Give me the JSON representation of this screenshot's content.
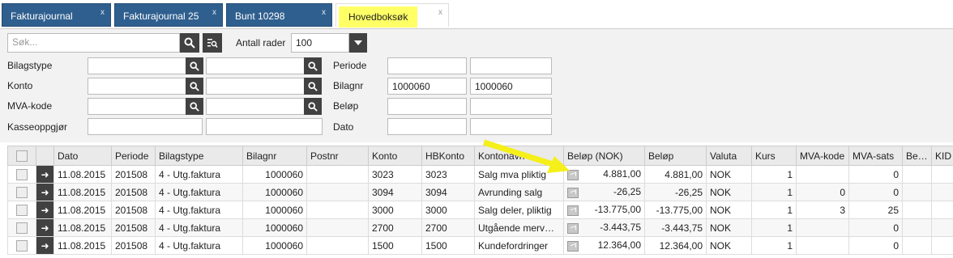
{
  "tabs": [
    {
      "label": "Fakturajournal",
      "close": "x"
    },
    {
      "label": "Fakturajournal 25",
      "close": "x"
    },
    {
      "label": "Bunt 10298",
      "close": "x"
    },
    {
      "label": "Hovedboksøk",
      "close": "x"
    }
  ],
  "search": {
    "placeholder": "Søk...",
    "rows_label": "Antall rader",
    "rows_value": "100"
  },
  "filters": {
    "bilagstype_label": "Bilagstype",
    "konto_label": "Konto",
    "mva_label": "MVA-kode",
    "kasse_label": "Kasseoppgjør",
    "periode_label": "Periode",
    "bilagnr_label": "Bilagnr",
    "belop_label": "Beløp",
    "dato_label": "Dato",
    "bilagnr_from": "1000060",
    "bilagnr_to": "1000060"
  },
  "grid": {
    "columns": [
      "Dato",
      "Periode",
      "Bilagstype",
      "Bilagnr",
      "Postnr",
      "Konto",
      "HBKonto",
      "Kontonavn",
      "Beløp (NOK)",
      "Beløp",
      "Valuta",
      "Kurs",
      "MVA-kode",
      "MVA-sats",
      "Be…",
      "KID"
    ],
    "rows": [
      {
        "dato": "11.08.2015",
        "periode": "201508",
        "bilagstype": "4 - Utg.faktura",
        "bilagnr": "1000060",
        "postnr": "",
        "konto": "3023",
        "hbkonto": "3023",
        "kontonavn": "Salg mva pliktig",
        "belop_nok": "4.881,00",
        "belop": "4.881,00",
        "valuta": "NOK",
        "kurs": "1",
        "mvakode": "",
        "mvasats": "0"
      },
      {
        "dato": "11.08.2015",
        "periode": "201508",
        "bilagstype": "4 - Utg.faktura",
        "bilagnr": "1000060",
        "postnr": "",
        "konto": "3094",
        "hbkonto": "3094",
        "kontonavn": "Avrunding salg",
        "belop_nok": "-26,25",
        "belop": "-26,25",
        "valuta": "NOK",
        "kurs": "1",
        "mvakode": "0",
        "mvasats": "0"
      },
      {
        "dato": "11.08.2015",
        "periode": "201508",
        "bilagstype": "4 - Utg.faktura",
        "bilagnr": "1000060",
        "postnr": "",
        "konto": "3000",
        "hbkonto": "3000",
        "kontonavn": "Salg deler, pliktig",
        "belop_nok": "-13.775,00",
        "belop": "-13.775,00",
        "valuta": "NOK",
        "kurs": "1",
        "mvakode": "3",
        "mvasats": "25"
      },
      {
        "dato": "11.08.2015",
        "periode": "201508",
        "bilagstype": "4 - Utg.faktura",
        "bilagnr": "1000060",
        "postnr": "",
        "konto": "2700",
        "hbkonto": "2700",
        "kontonavn": "Utgående merv…",
        "belop_nok": "-3.443,75",
        "belop": "-3.443,75",
        "valuta": "NOK",
        "kurs": "1",
        "mvakode": "",
        "mvasats": "0"
      },
      {
        "dato": "11.08.2015",
        "periode": "201508",
        "bilagstype": "4 - Utg.faktura",
        "bilagnr": "1000060",
        "postnr": "",
        "konto": "1500",
        "hbkonto": "1500",
        "kontonavn": "Kundefordringer",
        "belop_nok": "12.364,00",
        "belop": "12.364,00",
        "valuta": "NOK",
        "kurs": "1",
        "mvakode": "",
        "mvasats": "0"
      }
    ]
  },
  "colors": {
    "tab": "#2f5f8e",
    "highlight": "#ffff66",
    "arrow": "#f5ef1a",
    "dark_button": "#414141"
  }
}
